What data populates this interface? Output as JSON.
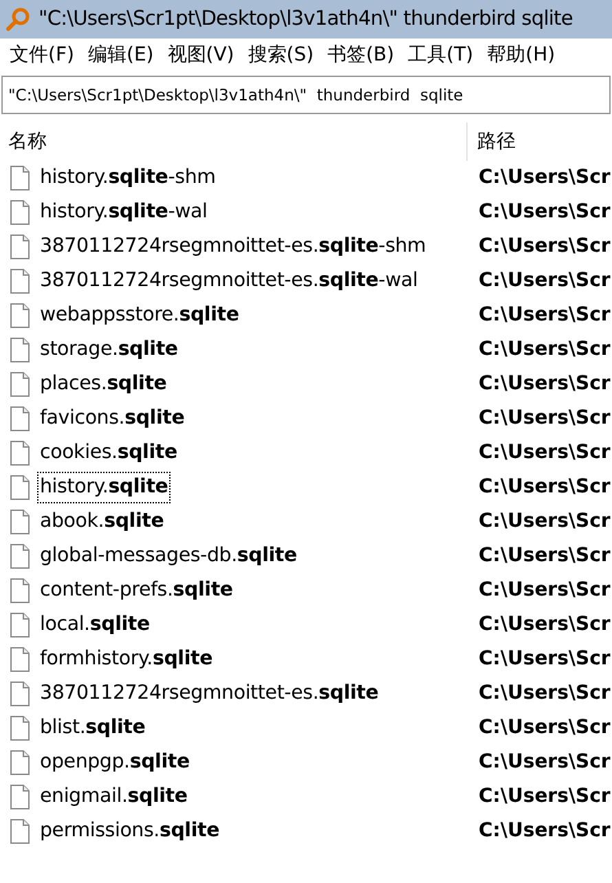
{
  "window": {
    "title": "\"C:\\Users\\Scr1pt\\Desktop\\l3v1ath4n\\\"  thunderbird  sqlite"
  },
  "menu": [
    "文件(F)",
    "编辑(E)",
    "视图(V)",
    "搜索(S)",
    "书签(B)",
    "工具(T)",
    "帮助(H)"
  ],
  "search": {
    "value": "\"C:\\Users\\Scr1pt\\Desktop\\l3v1ath4n\\\"  thunderbird  sqlite"
  },
  "table": {
    "columns": [
      "名称",
      "路径"
    ],
    "rows": [
      {
        "name": "history.**sqlite**-shm",
        "path": "C:\\Users\\Scr",
        "focused": false
      },
      {
        "name": "history.**sqlite**-wal",
        "path": "C:\\Users\\Scr",
        "focused": false
      },
      {
        "name": "3870112724rsegmnoittet-es.**sqlite**-shm",
        "path": "C:\\Users\\Scr",
        "focused": false
      },
      {
        "name": "3870112724rsegmnoittet-es.**sqlite**-wal",
        "path": "C:\\Users\\Scr",
        "focused": false
      },
      {
        "name": "webappsstore.**sqlite**",
        "path": "C:\\Users\\Scr",
        "focused": false
      },
      {
        "name": "storage.**sqlite**",
        "path": "C:\\Users\\Scr",
        "focused": false
      },
      {
        "name": "places.**sqlite**",
        "path": "C:\\Users\\Scr",
        "focused": false
      },
      {
        "name": "favicons.**sqlite**",
        "path": "C:\\Users\\Scr",
        "focused": false
      },
      {
        "name": "cookies.**sqlite**",
        "path": "C:\\Users\\Scr",
        "focused": false
      },
      {
        "name": "history.**sqlite**",
        "path": "C:\\Users\\Scr",
        "focused": true
      },
      {
        "name": "abook.**sqlite**",
        "path": "C:\\Users\\Scr",
        "focused": false
      },
      {
        "name": "global-messages-db.**sqlite**",
        "path": "C:\\Users\\Scr",
        "focused": false
      },
      {
        "name": "content-prefs.**sqlite**",
        "path": "C:\\Users\\Scr",
        "focused": false
      },
      {
        "name": "local.**sqlite**",
        "path": "C:\\Users\\Scr",
        "focused": false
      },
      {
        "name": "formhistory.**sqlite**",
        "path": "C:\\Users\\Scr",
        "focused": false
      },
      {
        "name": "3870112724rsegmnoittet-es.**sqlite**",
        "path": "C:\\Users\\Scr",
        "focused": false
      },
      {
        "name": "blist.**sqlite**",
        "path": "C:\\Users\\Scr",
        "focused": false
      },
      {
        "name": "openpgp.**sqlite**",
        "path": "C:\\Users\\Scr",
        "focused": false
      },
      {
        "name": "enigmail.**sqlite**",
        "path": "C:\\Users\\Scr",
        "focused": false
      },
      {
        "name": "permissions.**sqlite**",
        "path": "C:\\Users\\Scr",
        "focused": false
      }
    ]
  }
}
